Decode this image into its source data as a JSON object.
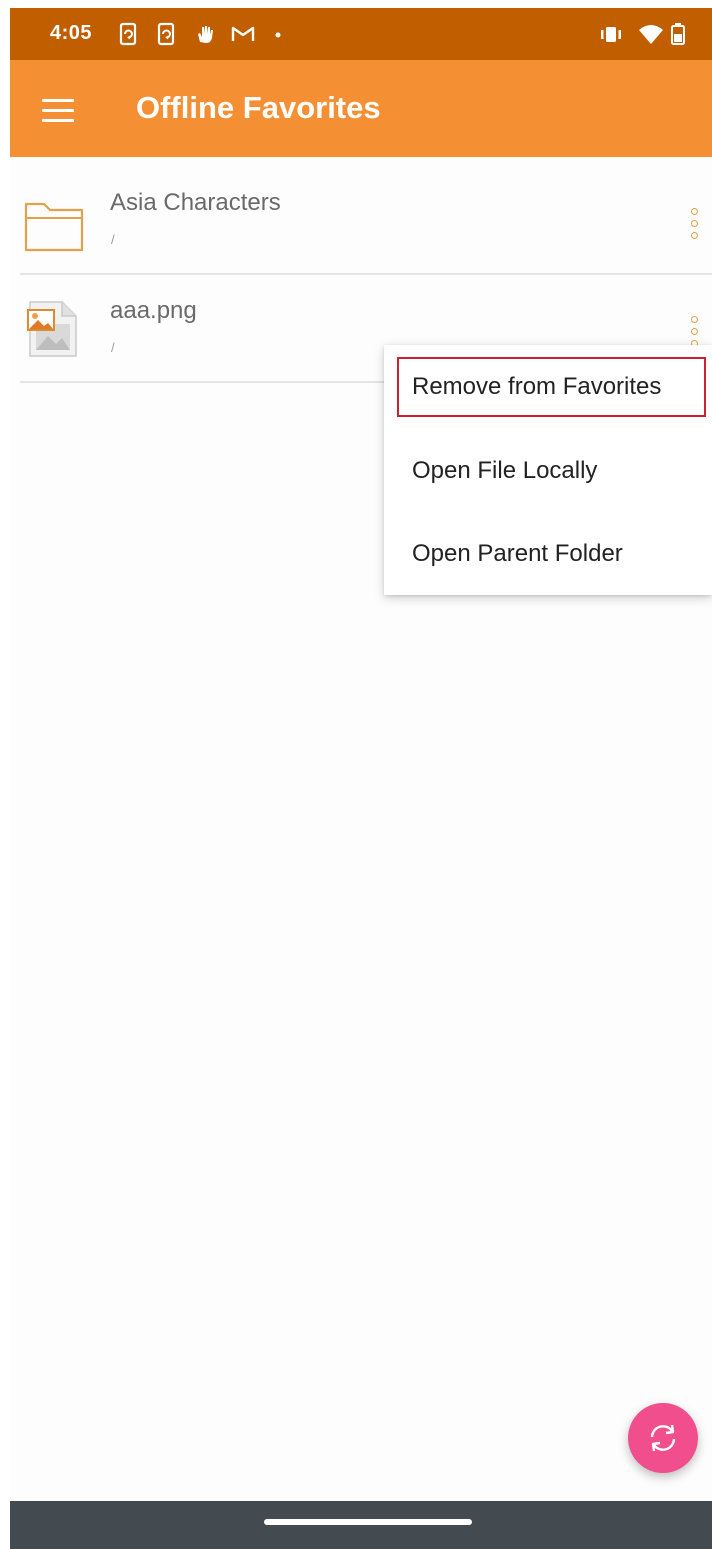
{
  "status_bar": {
    "time": "4:05",
    "left_icons": [
      "sync-phone-icon",
      "sync-phone-icon",
      "gesture-hand-icon",
      "gmail-icon",
      "dot-icon"
    ],
    "right_icons": [
      "vibrate-icon",
      "wifi-icon",
      "battery-icon"
    ],
    "background": "#c05e00"
  },
  "app_bar": {
    "title": "Offline Favorites",
    "background": "#f58f33",
    "menu_icon": "hamburger-menu-icon"
  },
  "files": [
    {
      "name": "Asia Characters",
      "path": "/",
      "icon": "folder-icon"
    },
    {
      "name": "aaa.png",
      "path": "/",
      "icon": "image-file-icon"
    }
  ],
  "context_menu": {
    "items": [
      {
        "label": "Remove from Favorites",
        "highlighted": true
      },
      {
        "label": "Open File Locally"
      },
      {
        "label": "Open Parent Folder"
      }
    ]
  },
  "fab": {
    "icon": "sync-icon",
    "color": "#f04e8c"
  },
  "colors": {
    "accent": "#f58f33",
    "highlight_border": "#d02030",
    "nav_bar": "#434a50"
  }
}
